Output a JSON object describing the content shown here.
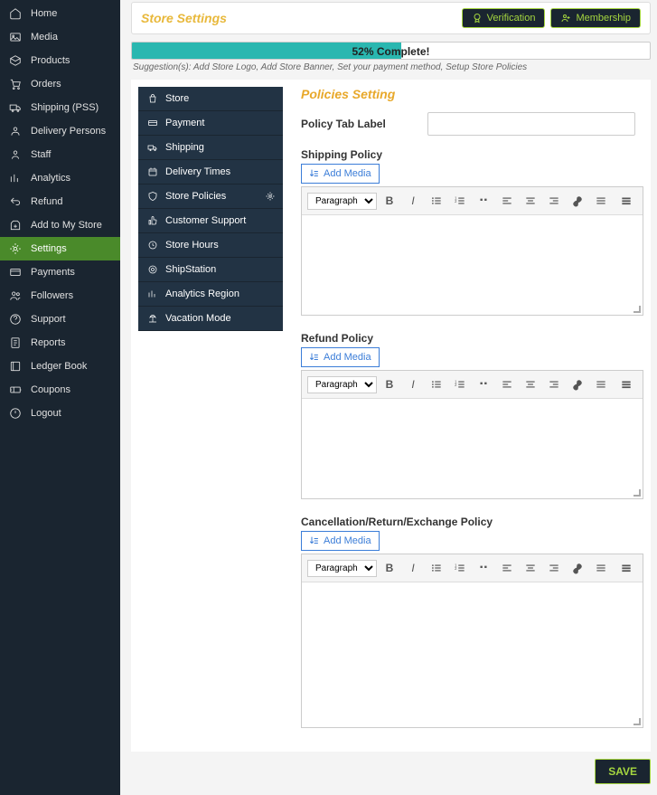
{
  "sidebar": {
    "items": [
      {
        "label": "Home",
        "icon": "home-icon"
      },
      {
        "label": "Media",
        "icon": "image-icon"
      },
      {
        "label": "Products",
        "icon": "box-icon"
      },
      {
        "label": "Orders",
        "icon": "cart-icon"
      },
      {
        "label": "Shipping (PSS)",
        "icon": "truck-icon"
      },
      {
        "label": "Delivery Persons",
        "icon": "person-icon"
      },
      {
        "label": "Staff",
        "icon": "user-icon"
      },
      {
        "label": "Analytics",
        "icon": "chart-icon"
      },
      {
        "label": "Refund",
        "icon": "refund-icon"
      },
      {
        "label": "Add to My Store",
        "icon": "plus-icon"
      },
      {
        "label": "Settings",
        "icon": "gear-icon",
        "active": true
      },
      {
        "label": "Payments",
        "icon": "card-icon"
      },
      {
        "label": "Followers",
        "icon": "users-icon"
      },
      {
        "label": "Support",
        "icon": "help-icon"
      },
      {
        "label": "Reports",
        "icon": "report-icon"
      },
      {
        "label": "Ledger Book",
        "icon": "book-icon"
      },
      {
        "label": "Coupons",
        "icon": "coupon-icon"
      },
      {
        "label": "Logout",
        "icon": "logout-icon"
      }
    ]
  },
  "header": {
    "title": "Store Settings",
    "verification": "Verification",
    "membership": "Membership"
  },
  "progress": {
    "percent": 52,
    "text": "52% Complete!",
    "suggestions": "Suggestion(s): Add Store Logo, Add Store Banner, Set your payment method, Setup Store Policies"
  },
  "subnav": {
    "items": [
      {
        "label": "Store",
        "icon": "bag-icon"
      },
      {
        "label": "Payment",
        "icon": "card-icon"
      },
      {
        "label": "Shipping",
        "icon": "truck-icon"
      },
      {
        "label": "Delivery Times",
        "icon": "clock-icon"
      },
      {
        "label": "Store Policies",
        "icon": "shield-icon",
        "active": true
      },
      {
        "label": "Customer Support",
        "icon": "thumbs-icon"
      },
      {
        "label": "Store Hours",
        "icon": "time-icon"
      },
      {
        "label": "ShipStation",
        "icon": "ship-icon"
      },
      {
        "label": "Analytics Region",
        "icon": "chart-icon"
      },
      {
        "label": "Vacation Mode",
        "icon": "vacation-icon"
      }
    ]
  },
  "form": {
    "section_title": "Policies Setting",
    "policy_tab_label": "Policy Tab Label",
    "policy_tab_value": "",
    "shipping_policy_label": "Shipping Policy",
    "refund_policy_label": "Refund Policy",
    "cancel_policy_label": "Cancellation/Return/Exchange Policy",
    "add_media": "Add Media",
    "paragraph": "Paragraph",
    "save": "SAVE"
  }
}
